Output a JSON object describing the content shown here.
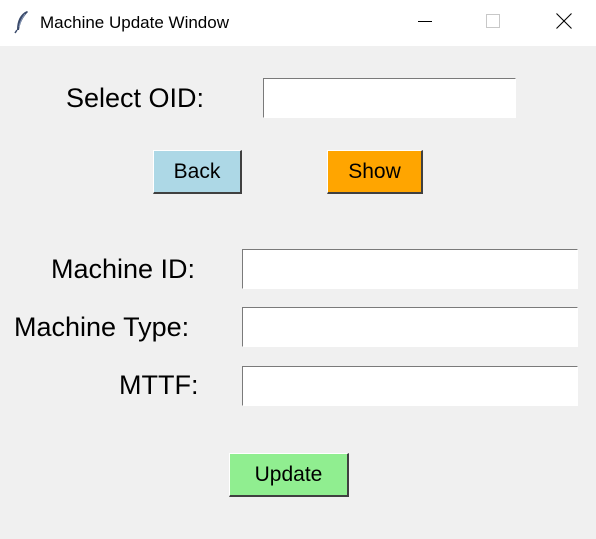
{
  "window": {
    "title": "Machine Update Window"
  },
  "icons": {
    "app": "feather-icon",
    "minimize": "minimize-icon",
    "maximize": "maximize-icon",
    "close": "close-icon"
  },
  "form": {
    "oid_label": "Select OID:",
    "oid_value": "",
    "machine_id_label": "Machine ID:",
    "machine_id_value": "",
    "machine_type_label": "Machine Type:",
    "machine_type_value": "",
    "mttf_label": "MTTF:",
    "mttf_value": ""
  },
  "buttons": {
    "back_label": "Back",
    "show_label": "Show",
    "update_label": "Update"
  },
  "colors": {
    "back_bg": "#add8e6",
    "show_bg": "#ffa500",
    "update_bg": "#90ee90"
  }
}
